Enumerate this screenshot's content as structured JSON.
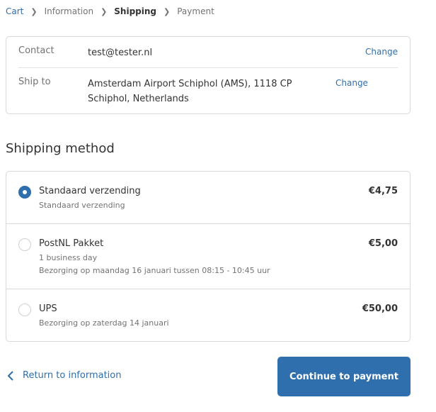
{
  "breadcrumb": {
    "items": [
      "Cart",
      "Information",
      "Shipping",
      "Payment"
    ]
  },
  "info": {
    "contact_label": "Contact",
    "contact_value": "test@tester.nl",
    "ship_label": "Ship to",
    "ship_value": "Amsterdam Airport Schiphol (AMS), 1118 CP Schiphol, Netherlands",
    "change": "Change"
  },
  "shipping": {
    "title": "Shipping method",
    "methods": [
      {
        "name": "Standaard verzending",
        "lines": [
          "Standaard verzending"
        ],
        "price": "€4,75",
        "selected": true
      },
      {
        "name": "PostNL Pakket",
        "lines": [
          "1 business day",
          "Bezorging op maandag 16 januari tussen 08:15 - 10:45 uur"
        ],
        "price": "€5,00",
        "selected": false
      },
      {
        "name": "UPS",
        "lines": [
          "Bezorging op zaterdag 14 januari"
        ],
        "price": "€50,00",
        "selected": false
      }
    ]
  },
  "footer": {
    "back": "Return to information",
    "continue": "Continue to payment"
  },
  "colors": {
    "accent": "#2f6fad"
  }
}
